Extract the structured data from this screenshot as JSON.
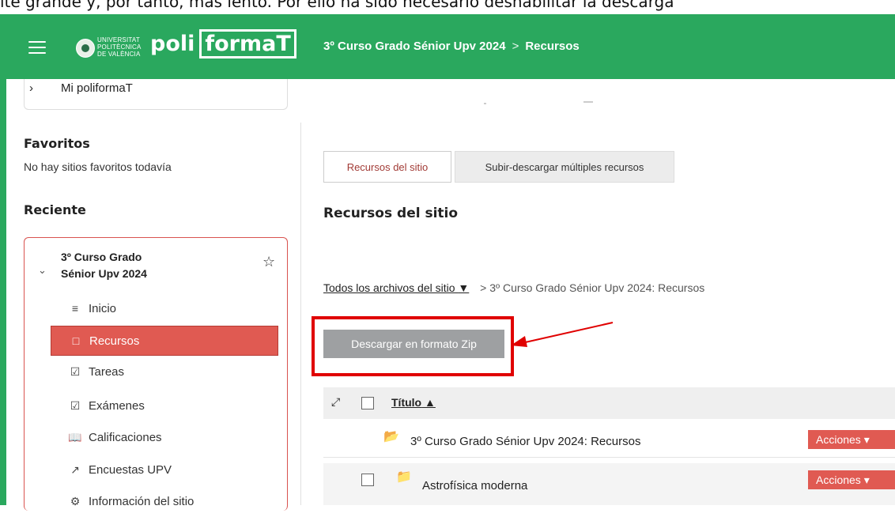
{
  "top_strip_text": "ite grande y, por tanto, más lento. Por ello ha sido necesario deshabilitar la descarga",
  "header": {
    "university_text": [
      "UNIVERSITAT",
      "POLITÈCNICA",
      "DE VALÈNCIA"
    ],
    "logo_left": "poli",
    "logo_right": "formaT",
    "breadcrumb_site": "3º Curso Grado Sénior Upv 2024",
    "breadcrumb_sep": ">",
    "breadcrumb_page": "Recursos"
  },
  "sidebar": {
    "mi_poliformat": "Mi poliformaT",
    "favorites_heading": "Favoritos",
    "favorites_empty": "No hay sitios favoritos todavía",
    "recent_heading": "Reciente",
    "site_name_line1": "3º Curso Grado",
    "site_name_line2": "Sénior Upv 2024",
    "items": [
      {
        "label": "Inicio",
        "icon": "list-icon"
      },
      {
        "label": "Recursos",
        "icon": "folder-icon"
      },
      {
        "label": "Tareas",
        "icon": "tasks-icon"
      },
      {
        "label": "Exámenes",
        "icon": "exam-icon"
      },
      {
        "label": "Calificaciones",
        "icon": "book-icon"
      },
      {
        "label": "Encuestas UPV",
        "icon": "chart-icon"
      },
      {
        "label": "Información del sitio",
        "icon": "gear-icon"
      }
    ]
  },
  "main": {
    "tabs": [
      "Recursos del sitio",
      "Subir-descargar múltiples recursos"
    ],
    "title": "Recursos del sitio",
    "path_all": "Todos los archivos del sitio",
    "path_rest": "> 3º Curso Grado Sénior Upv 2024: Recursos",
    "zip_button": "Descargar en formato Zip",
    "table": {
      "title_header": "Título",
      "rows": [
        {
          "name": "3º Curso Grado Sénior Upv 2024: Recursos",
          "action": "Acciones"
        },
        {
          "name": "Astrofísica moderna",
          "action": "Acciones"
        }
      ]
    }
  },
  "colors": {
    "header": "#2aa85e",
    "active": "#e05a52",
    "highlight": "#e00000"
  }
}
